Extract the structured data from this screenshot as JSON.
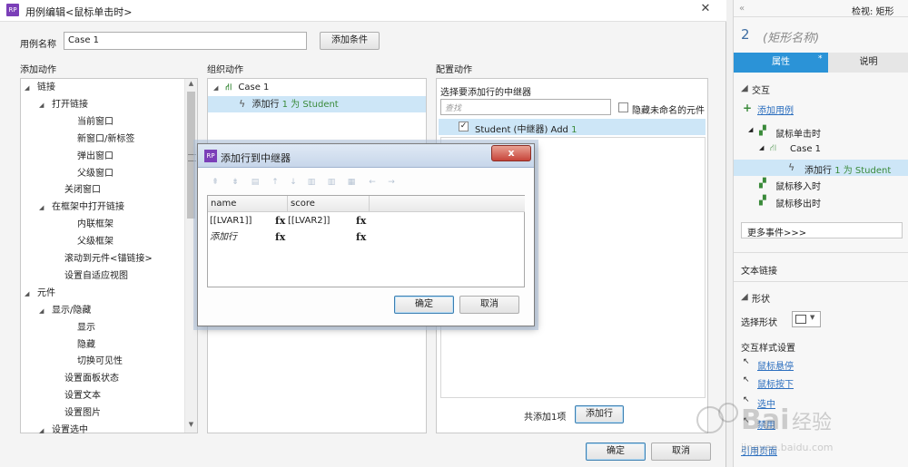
{
  "main": {
    "title": "用例编辑<鼠标单击时>",
    "close": "✕",
    "case_name_label": "用例名称",
    "case_name_value": "Case 1",
    "add_condition": "添加条件",
    "col_add_action": "添加动作",
    "col_org_action": "组织动作",
    "col_config_action": "配置动作",
    "tree": [
      {
        "label": "链接",
        "expand": "◢"
      },
      {
        "label": "打开链接",
        "expand": "◢"
      },
      {
        "label": "当前窗口",
        "expand": ""
      },
      {
        "label": "新窗口/新标签",
        "expand": ""
      },
      {
        "label": "弹出窗口",
        "expand": ""
      },
      {
        "label": "父级窗口",
        "expand": ""
      },
      {
        "label": "关闭窗口",
        "expand": ""
      },
      {
        "label": "在框架中打开链接",
        "expand": "◢"
      },
      {
        "label": "内联框架",
        "expand": ""
      },
      {
        "label": "父级框架",
        "expand": ""
      },
      {
        "label": "滚动到元件<锚链接>",
        "expand": ""
      },
      {
        "label": "设置自适应视图",
        "expand": ""
      },
      {
        "label": "元件",
        "expand": "◢"
      },
      {
        "label": "显示/隐藏",
        "expand": "◢"
      },
      {
        "label": "显示",
        "expand": ""
      },
      {
        "label": "隐藏",
        "expand": ""
      },
      {
        "label": "切换可见性",
        "expand": ""
      },
      {
        "label": "设置面板状态",
        "expand": ""
      },
      {
        "label": "设置文本",
        "expand": ""
      },
      {
        "label": "设置图片",
        "expand": ""
      },
      {
        "label": "设置选中",
        "expand": "◢"
      }
    ],
    "org": {
      "case_label": "Case 1",
      "action_prefix": "添加行",
      "action_suffix": "1 为 Student"
    },
    "config": {
      "select_label": "选择要添加行的中继器",
      "search_placeholder": "查找",
      "hide_unnamed": "隐藏未命名的元件",
      "repeater_item_name": "Student (中继器) Add",
      "repeater_item_count": "1",
      "total_added": "共添加1项",
      "add_row_btn": "添加行"
    },
    "ok": "确定",
    "cancel": "取消"
  },
  "popup": {
    "title": "添加行到中继器",
    "close": "x",
    "columns": [
      "name",
      "score"
    ],
    "rows": [
      {
        "name": "[[LVAR1]]",
        "score": "[[LVAR2]]",
        "fx": "fx"
      },
      {
        "name": "添加行",
        "score": "",
        "fx": "fx"
      }
    ],
    "ok": "确定",
    "cancel": "取消",
    "toolbar_icons": [
      "insert-row-above-icon",
      "insert-row-below-icon",
      "delete-row-icon",
      "move-up-icon",
      "move-down-icon",
      "insert-col-left-icon",
      "insert-col-right-icon",
      "delete-col-icon",
      "move-left-icon",
      "move-right-icon"
    ]
  },
  "inspector": {
    "header": "检视: 矩形",
    "shape_num": "2",
    "shape_name": "(矩形名称)",
    "tab_properties": "属性",
    "tab_notes": "说明",
    "section_interaction": "交互",
    "add_case": "添加用例",
    "event_click": "鼠标单击时",
    "case1": "Case 1",
    "action_prefix": "添加行",
    "action_suffix": "1 为 Student",
    "event_enter": "鼠标移入时",
    "event_leave": "鼠标移出时",
    "more_events": "更多事件>>>",
    "text_link": "文本链接",
    "section_shape": "形状",
    "select_shape": "选择形状",
    "interaction_style": "交互样式设置",
    "hover": "鼠标悬停",
    "mousedown": "鼠标按下",
    "selected": "选中",
    "disabled": "禁用",
    "ref_page": "引用页面"
  }
}
